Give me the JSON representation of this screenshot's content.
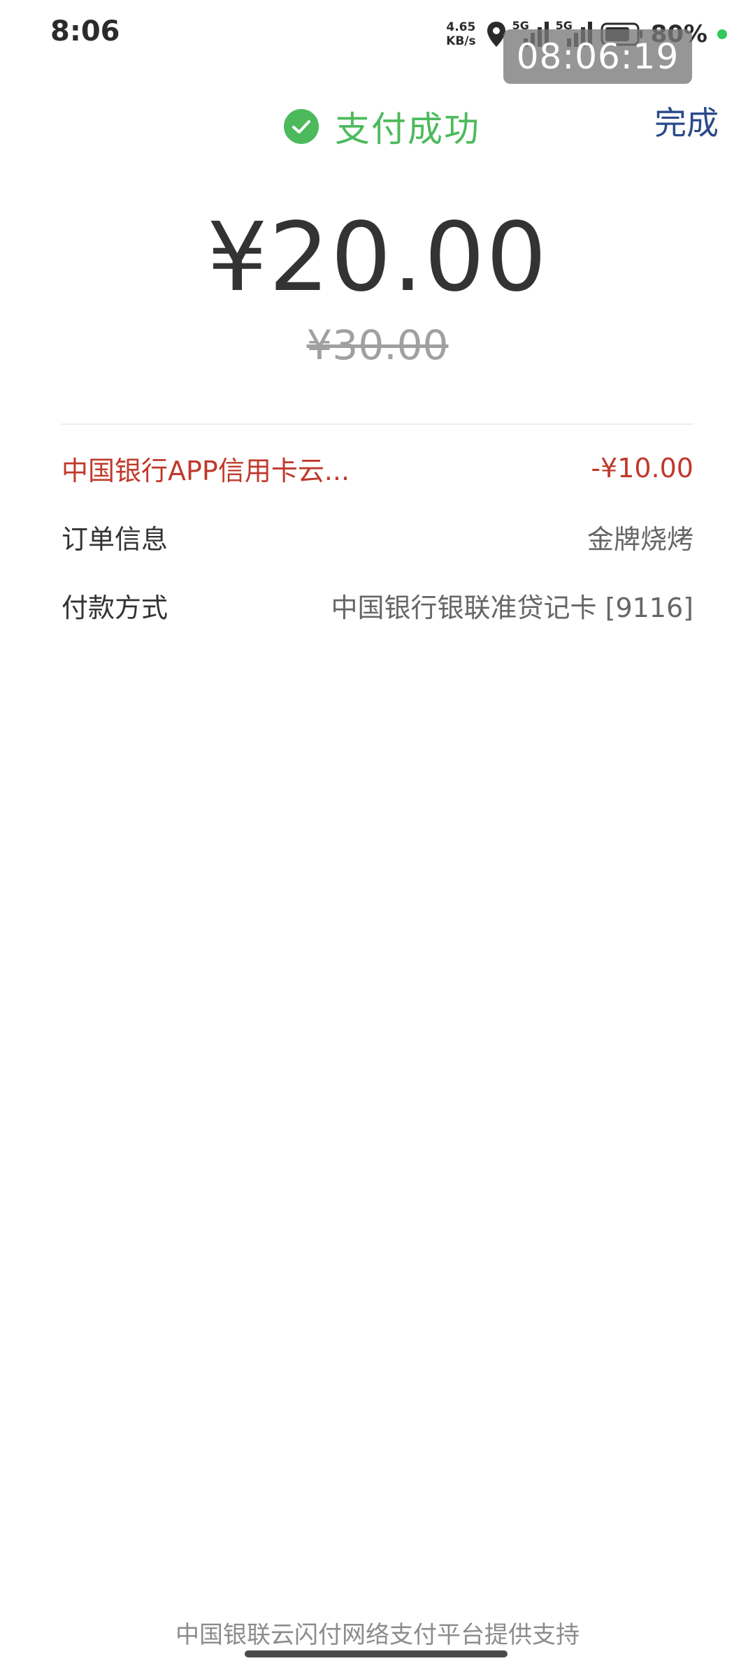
{
  "status_bar": {
    "time": "8:06",
    "net_speed_value": "4.65",
    "net_speed_unit": "KB/s",
    "sim1_label": "5G",
    "sim2_label": "5G",
    "battery_percent": "80%",
    "battery_level": 0.8,
    "icons": [
      "location-icon",
      "signal-icon",
      "battery-icon"
    ]
  },
  "timer_overlay": "08:06:19",
  "header": {
    "status_text": "支付成功",
    "done_label": "完成",
    "accent_color": "#4cba5c"
  },
  "payment": {
    "amount": "¥20.00",
    "original_amount": "¥30.00"
  },
  "details": {
    "discount": {
      "label": "中国银行APP信用卡云...",
      "value": "-¥10.00",
      "color": "#c0392b"
    },
    "order": {
      "label": "订单信息",
      "value": "金牌烧烤"
    },
    "payment_method": {
      "label": "付款方式",
      "value": "中国银行银联准贷记卡 [9116]"
    }
  },
  "footer": {
    "note": "中国银联云闪付网络支付平台提供支持"
  }
}
